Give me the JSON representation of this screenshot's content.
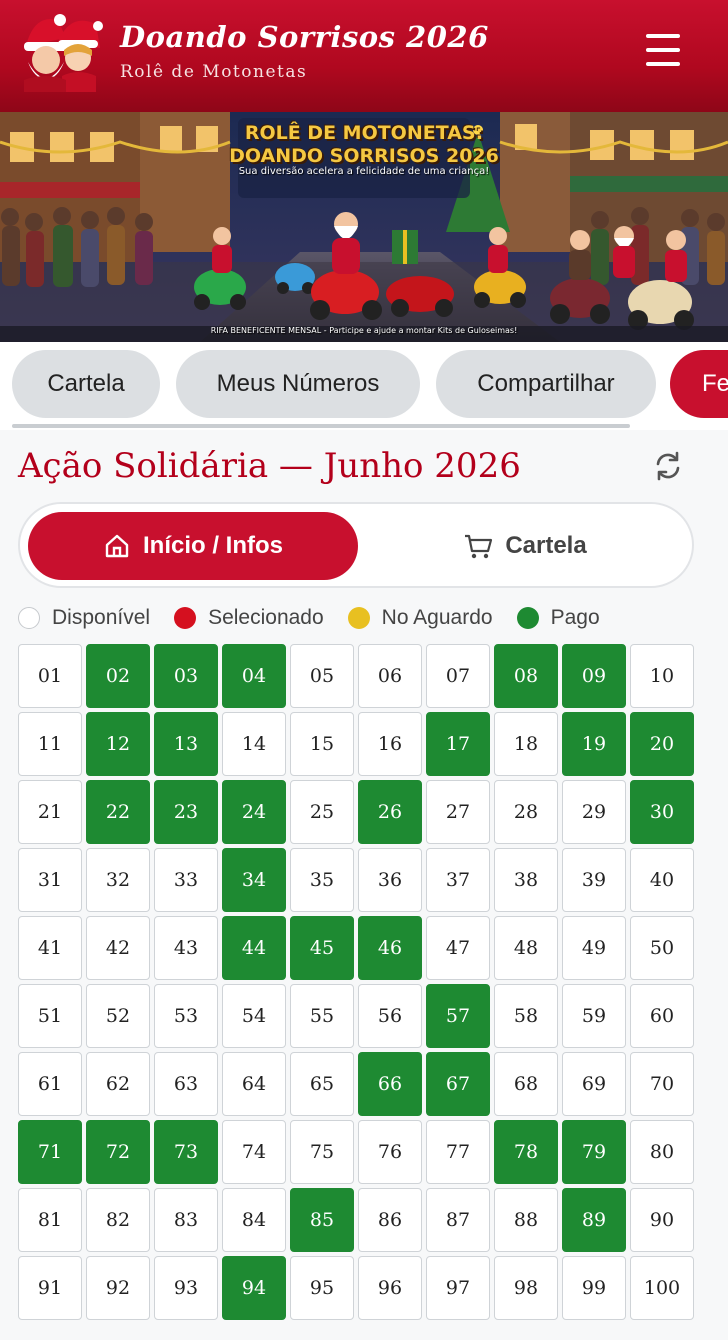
{
  "header": {
    "title": "Doando Sorrisos 2026",
    "subtitle": "Rolê de Motonetas",
    "menu_icon": "hamburger-menu-icon"
  },
  "banner": {
    "title_line1": "ROLÊ DE MOTONETAS:",
    "title_line2": "DOANDO SORRISOS 2026",
    "tagline": "Sua diversão acelera a felicidade de uma criança!",
    "footer": "RIFA BENEFICENTE MENSAL - Participe e ajude a montar Kits de Guloseimas!"
  },
  "tabs": [
    {
      "label": "Cartela"
    },
    {
      "label": "Meus Números"
    },
    {
      "label": "Compartilhar"
    },
    {
      "label": "Fe"
    }
  ],
  "section": {
    "title": "Ação Solidária — Junho 2026",
    "refresh_icon": "refresh-icon"
  },
  "segmented": {
    "active_label": "Início / Infos",
    "active_icon": "home-icon",
    "other_label": "Cartela",
    "other_icon": "cart-icon"
  },
  "legend": [
    {
      "label": "Disponível",
      "color": "#ffffff"
    },
    {
      "label": "Selecionado",
      "color": "#d5101f"
    },
    {
      "label": "No Aguardo",
      "color": "#e8c021"
    },
    {
      "label": "Pago",
      "color": "#1e8a32"
    }
  ],
  "colors": {
    "brand_red": "#c8102e",
    "paid_green": "#1e8a32"
  },
  "numbers": {
    "labels": [
      "01",
      "02",
      "03",
      "04",
      "05",
      "06",
      "07",
      "08",
      "09",
      "10",
      "11",
      "12",
      "13",
      "14",
      "15",
      "16",
      "17",
      "18",
      "19",
      "20",
      "21",
      "22",
      "23",
      "24",
      "25",
      "26",
      "27",
      "28",
      "29",
      "30",
      "31",
      "32",
      "33",
      "34",
      "35",
      "36",
      "37",
      "38",
      "39",
      "40",
      "41",
      "42",
      "43",
      "44",
      "45",
      "46",
      "47",
      "48",
      "49",
      "50",
      "51",
      "52",
      "53",
      "54",
      "55",
      "56",
      "57",
      "58",
      "59",
      "60",
      "61",
      "62",
      "63",
      "64",
      "65",
      "66",
      "67",
      "68",
      "69",
      "70",
      "71",
      "72",
      "73",
      "74",
      "75",
      "76",
      "77",
      "78",
      "79",
      "80",
      "81",
      "82",
      "83",
      "84",
      "85",
      "86",
      "87",
      "88",
      "89",
      "90",
      "91",
      "92",
      "93",
      "94",
      "95",
      "96",
      "97",
      "98",
      "99",
      "100"
    ],
    "paid": [
      2,
      3,
      4,
      8,
      9,
      12,
      13,
      17,
      19,
      20,
      22,
      23,
      24,
      26,
      30,
      34,
      44,
      45,
      46,
      57,
      66,
      67,
      71,
      72,
      73,
      78,
      79,
      85,
      89,
      94
    ]
  }
}
